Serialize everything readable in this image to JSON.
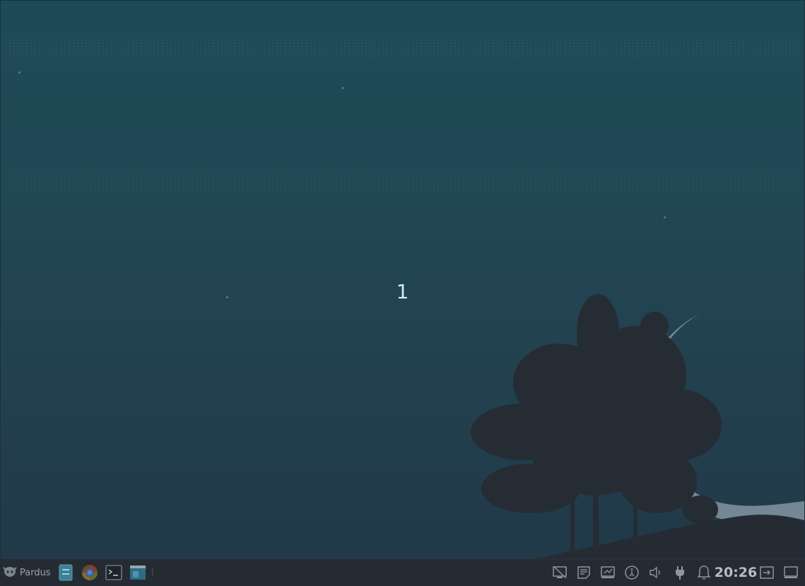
{
  "desktop": {
    "workspace_number": "1",
    "wallpaper": {
      "top_color": "#1e4a57",
      "bottom_color": "#213949",
      "moon_color": "#8fa1ad",
      "silhouette_color": "#232a33"
    }
  },
  "taskbar": {
    "menu_label": "Pardus",
    "menu_icon": "pardus-logo-icon",
    "launchers": [
      {
        "name": "file-manager-icon"
      },
      {
        "name": "web-browser-icon"
      },
      {
        "name": "terminal-icon"
      },
      {
        "name": "window-manager-icon"
      }
    ],
    "tray": [
      {
        "name": "screen-share-off-icon"
      },
      {
        "name": "notes-icon"
      },
      {
        "name": "screenshot-icon"
      },
      {
        "name": "accessibility-icon"
      },
      {
        "name": "volume-icon"
      },
      {
        "name": "power-plug-icon"
      },
      {
        "name": "notification-bell-icon"
      }
    ],
    "clock": "20:26",
    "end_icons": [
      {
        "name": "logout-icon"
      },
      {
        "name": "show-desktop-icon"
      }
    ],
    "colors": {
      "background": "#242b32",
      "icon": "#8d969e"
    }
  }
}
